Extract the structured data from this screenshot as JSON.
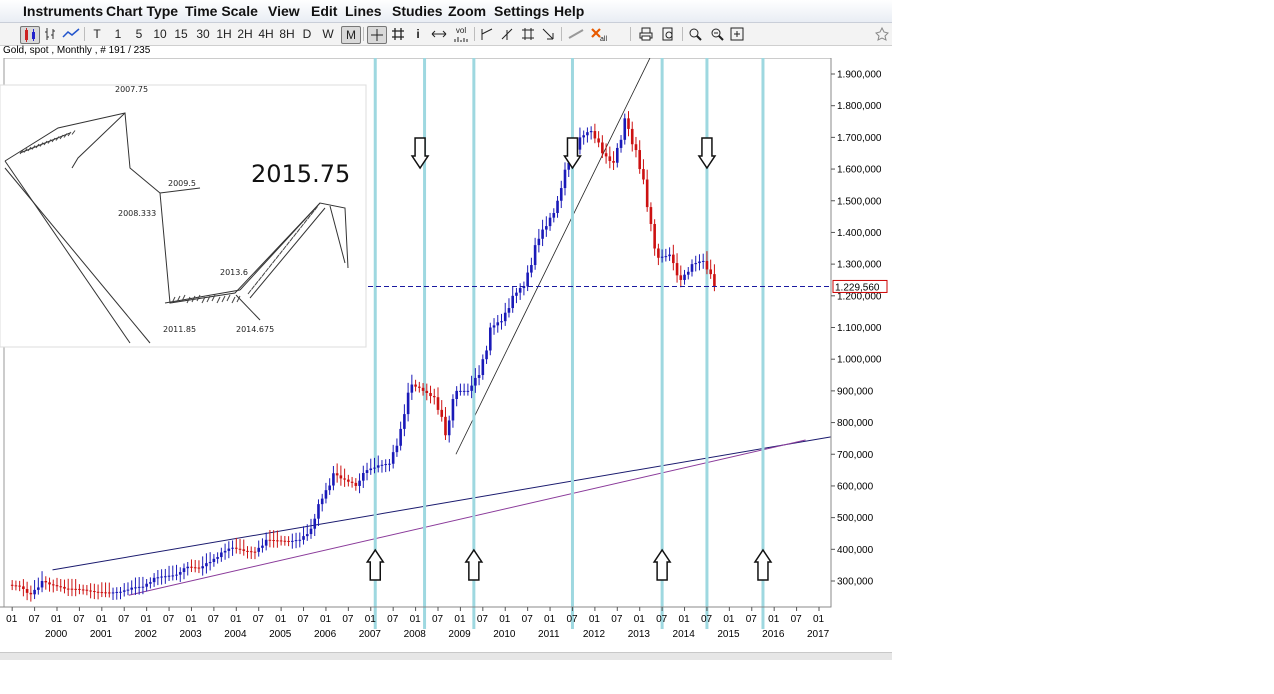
{
  "menu": [
    "Instruments",
    "Chart Type",
    "Time Scale",
    "View",
    "Edit",
    "Lines",
    "Studies",
    "Zoom",
    "Settings",
    "Help"
  ],
  "toolbar": {
    "timeframes": [
      "T",
      "1",
      "5",
      "10",
      "15",
      "30",
      "1H",
      "2H",
      "4H",
      "8H",
      "D",
      "W",
      "M"
    ],
    "selected_timeframe": "M",
    "vol_label": "vol",
    "all_label": "all",
    "info_label": "i"
  },
  "chart_title": "Gold, spot , Monthly , # 191 / 235",
  "current_price_label": "1.229,560",
  "inset": {
    "big_label": "2015.75",
    "labels": [
      "2007.75",
      "2009.5",
      "2008.333",
      "2013.6",
      "2011.85",
      "2014.675"
    ]
  },
  "colors": {
    "up_candle": "#1a1ab8",
    "down_candle": "#cc1111",
    "cycle_line": "#9ed8e0",
    "trend_line_blue": "#1a1a6e",
    "trend_line_purple": "#8a3a9a",
    "price_line": "#1a1aa0",
    "price_label_border": "#cc0000"
  },
  "chart_data": {
    "type": "candlestick",
    "instrument": "Gold, spot",
    "timeframe": "Monthly",
    "y_ticks": [
      1900000,
      1800000,
      1700000,
      1600000,
      1500000,
      1400000,
      1300000,
      1200000,
      1100000,
      1000000,
      900000,
      800000,
      700000,
      600000,
      500000,
      400000,
      300000
    ],
    "y_tick_labels": [
      "1.900,000",
      "1.800,000",
      "1.700,000",
      "1.600,000",
      "1.500,000",
      "1.400,000",
      "1.300,000",
      "1.200,000",
      "1.100,000",
      "1.000,000",
      "900,000",
      "800,000",
      "700,000",
      "600,000",
      "500,000",
      "400,000",
      "300,000"
    ],
    "ylim": [
      200000,
      1950000
    ],
    "x_year_labels": [
      "2000",
      "2001",
      "2002",
      "2003",
      "2004",
      "2005",
      "2006",
      "2007",
      "2008",
      "2009",
      "2010",
      "2011",
      "2012",
      "2013",
      "2014",
      "2015",
      "2016",
      "2017"
    ],
    "x_month_labels": [
      "01",
      "07"
    ],
    "x_start": 1999.0,
    "x_end": 2017.4,
    "current_price": 1229560,
    "monthly_closes": [
      {
        "t": 1999.0,
        "c": 288000
      },
      {
        "t": 1999.25,
        "c": 283000
      },
      {
        "t": 1999.5,
        "c": 258000
      },
      {
        "t": 1999.75,
        "c": 300000
      },
      {
        "t": 2000.0,
        "c": 287000
      },
      {
        "t": 2000.25,
        "c": 276000
      },
      {
        "t": 2000.5,
        "c": 275000
      },
      {
        "t": 2000.75,
        "c": 270000
      },
      {
        "t": 2001.0,
        "c": 265000
      },
      {
        "t": 2001.25,
        "c": 263000
      },
      {
        "t": 2001.5,
        "c": 266000
      },
      {
        "t": 2001.75,
        "c": 279000
      },
      {
        "t": 2002.0,
        "c": 282000
      },
      {
        "t": 2002.25,
        "c": 310000
      },
      {
        "t": 2002.5,
        "c": 315000
      },
      {
        "t": 2002.75,
        "c": 320000
      },
      {
        "t": 2003.0,
        "c": 345000
      },
      {
        "t": 2003.25,
        "c": 340000
      },
      {
        "t": 2003.5,
        "c": 360000
      },
      {
        "t": 2003.75,
        "c": 390000
      },
      {
        "t": 2004.0,
        "c": 405000
      },
      {
        "t": 2004.25,
        "c": 395000
      },
      {
        "t": 2004.5,
        "c": 392000
      },
      {
        "t": 2004.75,
        "c": 430000
      },
      {
        "t": 2005.0,
        "c": 428000
      },
      {
        "t": 2005.25,
        "c": 425000
      },
      {
        "t": 2005.5,
        "c": 430000
      },
      {
        "t": 2005.75,
        "c": 465000
      },
      {
        "t": 2006.0,
        "c": 560000
      },
      {
        "t": 2006.25,
        "c": 640000
      },
      {
        "t": 2006.5,
        "c": 620000
      },
      {
        "t": 2006.75,
        "c": 600000
      },
      {
        "t": 2007.0,
        "c": 650000
      },
      {
        "t": 2007.25,
        "c": 665000
      },
      {
        "t": 2007.5,
        "c": 670000
      },
      {
        "t": 2007.75,
        "c": 780000
      },
      {
        "t": 2008.0,
        "c": 920000
      },
      {
        "t": 2008.25,
        "c": 900000
      },
      {
        "t": 2008.5,
        "c": 880000
      },
      {
        "t": 2008.75,
        "c": 760000
      },
      {
        "t": 2009.0,
        "c": 900000
      },
      {
        "t": 2009.25,
        "c": 900000
      },
      {
        "t": 2009.5,
        "c": 950000
      },
      {
        "t": 2009.75,
        "c": 1100000
      },
      {
        "t": 2010.0,
        "c": 1120000
      },
      {
        "t": 2010.25,
        "c": 1200000
      },
      {
        "t": 2010.5,
        "c": 1230000
      },
      {
        "t": 2010.75,
        "c": 1360000
      },
      {
        "t": 2011.0,
        "c": 1420000
      },
      {
        "t": 2011.25,
        "c": 1500000
      },
      {
        "t": 2011.5,
        "c": 1620000
      },
      {
        "t": 2011.75,
        "c": 1700000
      },
      {
        "t": 2012.0,
        "c": 1720000
      },
      {
        "t": 2012.25,
        "c": 1650000
      },
      {
        "t": 2012.5,
        "c": 1620000
      },
      {
        "t": 2012.75,
        "c": 1760000
      },
      {
        "t": 2013.0,
        "c": 1660000
      },
      {
        "t": 2013.25,
        "c": 1480000
      },
      {
        "t": 2013.5,
        "c": 1320000
      },
      {
        "t": 2013.75,
        "c": 1330000
      },
      {
        "t": 2014.0,
        "c": 1250000
      },
      {
        "t": 2014.25,
        "c": 1300000
      },
      {
        "t": 2014.5,
        "c": 1310000
      },
      {
        "t": 2014.75,
        "c": 1229560
      }
    ],
    "cycle_line_dates": [
      2007.1,
      2008.2,
      2009.3,
      2011.5,
      2013.5,
      2014.5,
      2015.75
    ],
    "arrows_down": [
      2008.1,
      2011.5,
      2014.5
    ],
    "arrows_up": [
      2007.1,
      2009.3,
      2013.5,
      2015.75
    ]
  }
}
